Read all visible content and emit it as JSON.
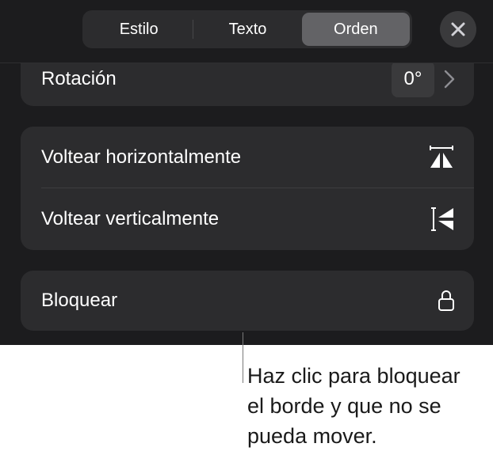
{
  "tabs": [
    {
      "label": "Estilo",
      "active": false
    },
    {
      "label": "Texto",
      "active": false
    },
    {
      "label": "Orden",
      "active": true
    }
  ],
  "close": {
    "icon": "close-icon"
  },
  "rotation": {
    "label": "Rotación",
    "value": "0°",
    "icon": "chevron-right-icon"
  },
  "flip": {
    "horizontal": {
      "label": "Voltear horizontalmente",
      "icon": "flip-horizontal-icon"
    },
    "vertical": {
      "label": "Voltear verticalmente",
      "icon": "flip-vertical-icon"
    }
  },
  "lock": {
    "label": "Bloquear",
    "icon": "lock-icon"
  },
  "callout": {
    "text": "Haz clic para bloquear\nel borde y que no se\npueda mover."
  },
  "colors": {
    "panel_bg": "#1c1c1e",
    "group_bg": "#2c2c2e",
    "active_tab": "#636366",
    "text": "#ffffff"
  }
}
